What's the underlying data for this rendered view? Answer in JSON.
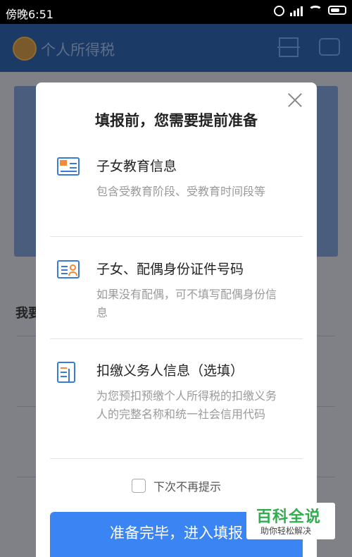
{
  "status_bar": {
    "time": "傍晚6:51"
  },
  "app_header": {
    "title": "个人所得税",
    "icons": [
      "emblem-icon",
      "scan-icon",
      "message-icon"
    ]
  },
  "background": {
    "section_heading": "我要"
  },
  "modal": {
    "title": "填报前，您需要提前准备",
    "items": [
      {
        "icon": "education-id-card-icon",
        "label": "子女教育信息",
        "description": "包含受教育阶段、受教育时间段等"
      },
      {
        "icon": "person-id-card-icon",
        "label": "子女、配偶身份证件号码",
        "description": "如果没有配偶，可不填写配偶身份信息"
      },
      {
        "icon": "building-document-icon",
        "label": "扣缴义务人信息（选填）",
        "description": "为您预扣预缴个人所得税的扣缴义务人的完整名称和统一社会信用代码"
      }
    ],
    "checkbox_label": "下次不再提示",
    "primary_button": "准备完毕，进入填报"
  },
  "watermark": {
    "title": "百科全说",
    "subtitle": "助你轻松解决"
  }
}
